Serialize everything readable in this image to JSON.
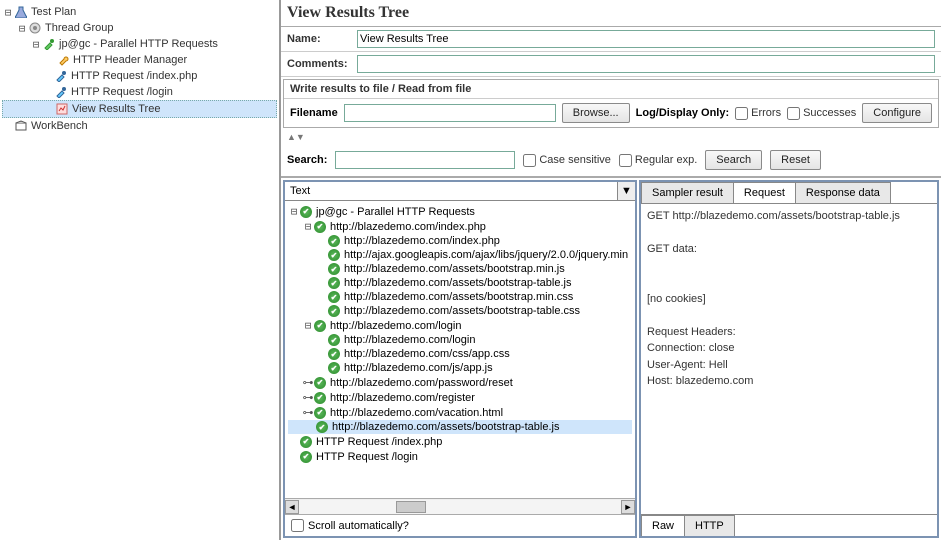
{
  "left_tree": {
    "test_plan": "Test Plan",
    "thread_group": "Thread Group",
    "parallel": "jp@gc - Parallel HTTP Requests",
    "header_mgr": "HTTP Header Manager",
    "req_index": "HTTP Request /index.php",
    "req_login": "HTTP Request /login",
    "view_results": "View Results Tree",
    "workbench": "WorkBench"
  },
  "panel": {
    "title": "View Results Tree",
    "name_label": "Name:",
    "name_value": "View Results Tree",
    "comments_label": "Comments:",
    "write_title": "Write results to file / Read from file",
    "filename_label": "Filename",
    "browse": "Browse...",
    "logdisplay": "Log/Display Only:",
    "errors": "Errors",
    "successes": "Successes",
    "configure": "Configure",
    "search_label": "Search:",
    "case_sensitive": "Case sensitive",
    "regex": "Regular exp.",
    "search_btn": "Search",
    "reset_btn": "Reset",
    "combo_value": "Text",
    "scroll_auto": "Scroll automatically?"
  },
  "results": {
    "root": "jp@gc - Parallel HTTP Requests",
    "r1": "http://blazedemo.com/index.php",
    "r1a": "http://blazedemo.com/index.php",
    "r1b": "http://ajax.googleapis.com/ajax/libs/jquery/2.0.0/jquery.min",
    "r1c": "http://blazedemo.com/assets/bootstrap.min.js",
    "r1d": "http://blazedemo.com/assets/bootstrap-table.js",
    "r1e": "http://blazedemo.com/assets/bootstrap.min.css",
    "r1f": "http://blazedemo.com/assets/bootstrap-table.css",
    "r2": "http://blazedemo.com/login",
    "r2a": "http://blazedemo.com/login",
    "r2b": "http://blazedemo.com/css/app.css",
    "r2c": "http://blazedemo.com/js/app.js",
    "r3": "http://blazedemo.com/password/reset",
    "r4": "http://blazedemo.com/register",
    "r5": "http://blazedemo.com/vacation.html",
    "r6": "http://blazedemo.com/assets/bootstrap-table.js",
    "bottom1": "HTTP Request /index.php",
    "bottom2": "HTTP Request /login"
  },
  "detail_tabs": {
    "sampler": "Sampler result",
    "request": "Request",
    "response": "Response data",
    "raw": "Raw",
    "http": "HTTP"
  },
  "detail_body": "GET http://blazedemo.com/assets/bootstrap-table.js\n\nGET data:\n\n\n[no cookies]\n\nRequest Headers:\nConnection: close\nUser-Agent: Hell\nHost: blazedemo.com"
}
